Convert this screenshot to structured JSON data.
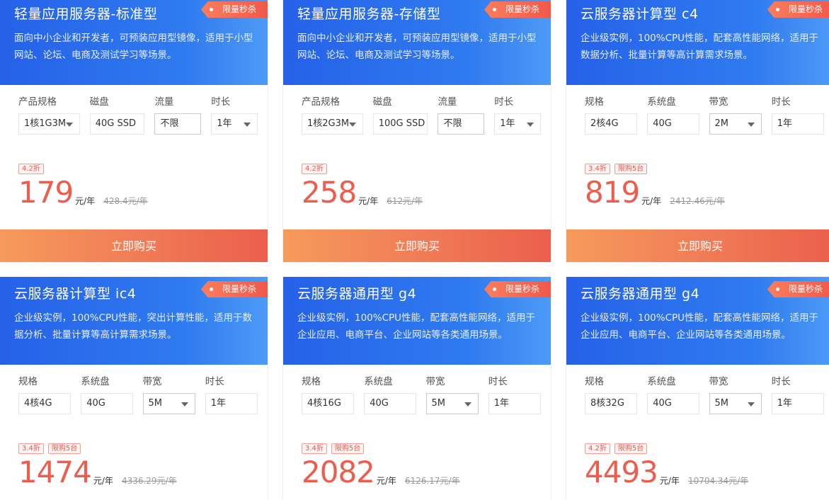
{
  "cards": [
    {
      "title": "轻量应用服务器-标准型",
      "tag": "限量秒杀",
      "desc": "面向中小企业和开发者，可预装应用型镜像，适用于小型网站、论坛、电商及测试学习等场景。",
      "specs": [
        {
          "label": "产品规格",
          "value": "1核1G3M"
        },
        {
          "label": "磁盘",
          "value": "40G SSD"
        },
        {
          "label": "流量",
          "value": "不限"
        },
        {
          "label": "时长",
          "value": "1年"
        }
      ],
      "badges": [
        "4.2折"
      ],
      "price": "179",
      "unit": "元/年",
      "orig": "428.4元/年",
      "buy": "立即购买"
    },
    {
      "title": "轻量应用服务器-存储型",
      "tag": "限量秒杀",
      "desc": "面向中小企业和开发者，可预装应用型镜像，适用于小型网站、论坛、电商及测试学习等场景。",
      "specs": [
        {
          "label": "产品规格",
          "value": "1核2G3M"
        },
        {
          "label": "磁盘",
          "value": "100G SSD"
        },
        {
          "label": "流量",
          "value": "不限"
        },
        {
          "label": "时长",
          "value": "1年"
        }
      ],
      "badges": [
        "4.2折"
      ],
      "price": "258",
      "unit": "元/年",
      "orig": "612元/年",
      "buy": "立即购买"
    },
    {
      "title": "云服务器计算型 c4",
      "tag": "限量秒杀",
      "desc": "企业级实例，100%CPU性能，配套高性能网络，适用于数据分析、批量计算等高计算需求场景。",
      "specs": [
        {
          "label": "规格",
          "value": "2核4G"
        },
        {
          "label": "系统盘",
          "value": "40G"
        },
        {
          "label": "带宽",
          "value": "2M"
        },
        {
          "label": "时长",
          "value": "1年"
        }
      ],
      "badges": [
        "3.4折",
        "限购5台"
      ],
      "price": "819",
      "unit": "元/年",
      "orig": "2412.46元/年",
      "buy": "立即购买"
    },
    {
      "title": "云服务器计算型 ic4",
      "tag": "限量秒杀",
      "desc": "企业级实例，100%CPU性能，突出计算性能，适用于数据分析、批量计算等高计算需求场景。",
      "specs": [
        {
          "label": "规格",
          "value": "4核4G"
        },
        {
          "label": "系统盘",
          "value": "40G"
        },
        {
          "label": "带宽",
          "value": "5M"
        },
        {
          "label": "时长",
          "value": "1年"
        }
      ],
      "badges": [
        "3.4折",
        "限购5台"
      ],
      "price": "1474",
      "unit": "元/年",
      "orig": "4336.29元/年"
    },
    {
      "title": "云服务器通用型 g4",
      "tag": "限量秒杀",
      "desc": "企业级实例，100%CPU性能，配套高性能网络，适用于企业应用、电商平台、企业网站等各类通用场景。",
      "specs": [
        {
          "label": "规格",
          "value": "4核16G"
        },
        {
          "label": "系统盘",
          "value": "40G"
        },
        {
          "label": "带宽",
          "value": "5M"
        },
        {
          "label": "时长",
          "value": "1年"
        }
      ],
      "badges": [
        "3.4折",
        "限购5台"
      ],
      "price": "2082",
      "unit": "元/年",
      "orig": "6126.17元/年"
    },
    {
      "title": "云服务器通用型 g4",
      "tag": "限量秒杀",
      "desc": "企业级实例，100%CPU性能，配套高性能网络，适用于企业应用、电商平台、企业网站等各类通用场景。",
      "specs": [
        {
          "label": "规格",
          "value": "8核32G"
        },
        {
          "label": "系统盘",
          "value": "40G"
        },
        {
          "label": "带宽",
          "value": "5M"
        },
        {
          "label": "时长",
          "value": "1年"
        }
      ],
      "badges": [
        "4.2折",
        "限购5台"
      ],
      "price": "4493",
      "unit": "元/年",
      "orig": "10704.34元/年"
    }
  ]
}
